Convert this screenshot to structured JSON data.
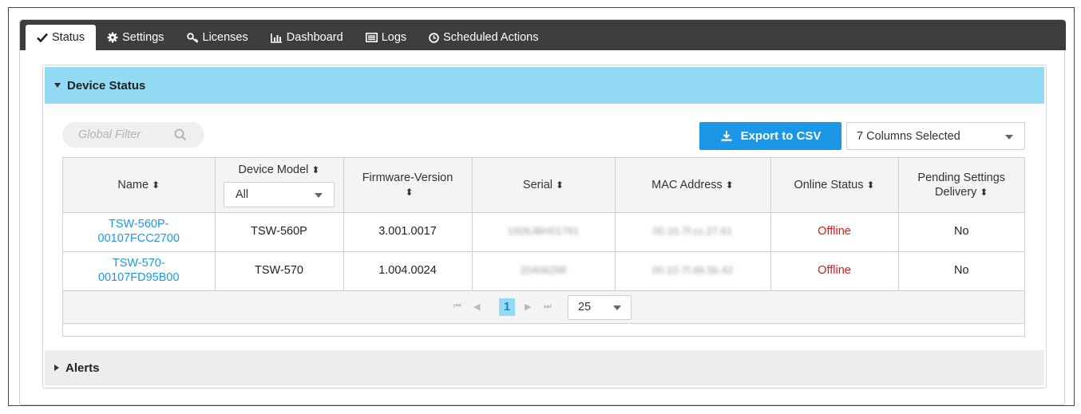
{
  "tabs": [
    {
      "label": "Status",
      "icon": "check-icon",
      "active": true
    },
    {
      "label": "Settings",
      "icon": "gear-icon"
    },
    {
      "label": "Licenses",
      "icon": "key-icon"
    },
    {
      "label": "Dashboard",
      "icon": "bar-chart-icon"
    },
    {
      "label": "Logs",
      "icon": "list-icon"
    },
    {
      "label": "Scheduled Actions",
      "icon": "clock-icon"
    }
  ],
  "device_status": {
    "title": "Device Status",
    "filter_placeholder": "Global Filter",
    "export_label": "Export to CSV",
    "columns_selected": "7 Columns Selected",
    "columns": [
      {
        "label": "Name",
        "sortable": true
      },
      {
        "label": "Device Model",
        "sortable": true,
        "filter": "All"
      },
      {
        "label": "Firmware-Version",
        "sortable": true
      },
      {
        "label": "Serial",
        "sortable": true
      },
      {
        "label": "MAC Address",
        "sortable": true
      },
      {
        "label": "Online Status",
        "sortable": true
      },
      {
        "label": "Pending Settings Delivery",
        "sortable": true
      }
    ],
    "rows": [
      {
        "name_line1": "TSW-560P-",
        "name_line2": "00107FCC2700",
        "model": "TSW-560P",
        "firmware": "3.001.0017",
        "serial": "1926JBH01781",
        "mac": "00.10.7f.cc.27.61",
        "status": "Offline",
        "pending": "No"
      },
      {
        "name_line1": "TSW-570-",
        "name_line2": "00107FD95B00",
        "model": "TSW-570",
        "firmware": "1.004.0024",
        "serial": "20406298",
        "mac": "00.10.7f.d9.5b.42",
        "status": "Offline",
        "pending": "No"
      }
    ],
    "pager": {
      "first": "⏮",
      "prev": "◀",
      "current_page": "1",
      "next": "▶",
      "last": "⏭",
      "page_size": "25"
    }
  },
  "alerts": {
    "title": "Alerts"
  },
  "colors": {
    "tab_bar": "#3d3d3d",
    "section_header": "#93dbf4",
    "accent": "#1c97e8",
    "offline": "#e0181b"
  }
}
